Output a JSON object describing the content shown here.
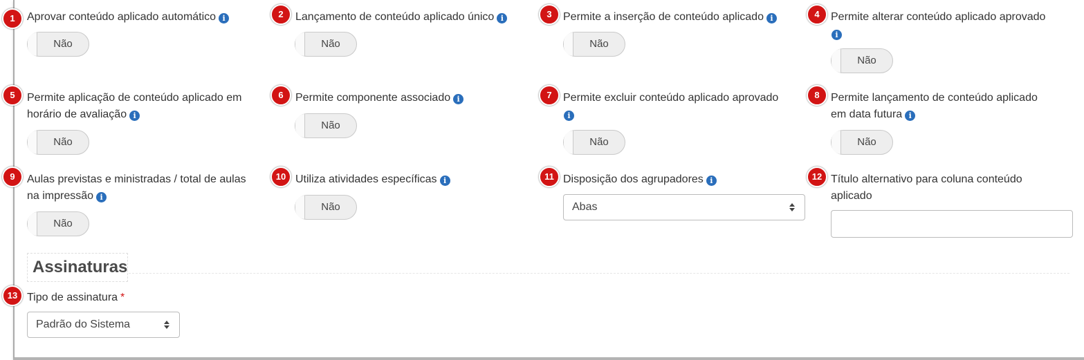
{
  "fields": [
    {
      "badge": "1",
      "label": "Aprovar conteúdo aplicado automático",
      "value": "Não"
    },
    {
      "badge": "2",
      "label": "Lançamento de conteúdo aplicado único",
      "value": "Não"
    },
    {
      "badge": "3",
      "label": "Permite a inserção de conteúdo aplicado",
      "value": "Não"
    },
    {
      "badge": "4",
      "label": "Permite alterar conteúdo aplicado aprovado",
      "value": "Não"
    },
    {
      "badge": "5",
      "label_line1": "Permite aplicação de conteúdo aplicado em",
      "label_line2": "horário de avaliação",
      "value": "Não"
    },
    {
      "badge": "6",
      "label": "Permite componente associado",
      "value": "Não"
    },
    {
      "badge": "7",
      "label": "Permite excluir conteúdo aplicado aprovado",
      "value": "Não"
    },
    {
      "badge": "8",
      "label_line1": "Permite lançamento de conteúdo aplicado",
      "label_line2": "em data futura",
      "value": "Não"
    },
    {
      "badge": "9",
      "label_line1": "Aulas previstas e ministradas / total de aulas",
      "label_line2": "na impressão",
      "value": "Não"
    },
    {
      "badge": "10",
      "label": "Utiliza atividades específicas",
      "value": "Não"
    },
    {
      "badge": "11",
      "label": "Disposição dos agrupadores",
      "value": "Abas"
    },
    {
      "badge": "12",
      "label_line1": "Título alternativo para coluna conteúdo",
      "label_line2": "aplicado",
      "value": ""
    }
  ],
  "section": {
    "title": "Assinaturas"
  },
  "signature": {
    "badge": "13",
    "label": "Tipo de assinatura",
    "required": "*",
    "value": "Padrão do Sistema"
  },
  "icons": {
    "info": "info-circle-icon",
    "select": "sort-arrows-icon"
  },
  "colors": {
    "badge": "#d21414",
    "info": "#2a6ebb"
  }
}
